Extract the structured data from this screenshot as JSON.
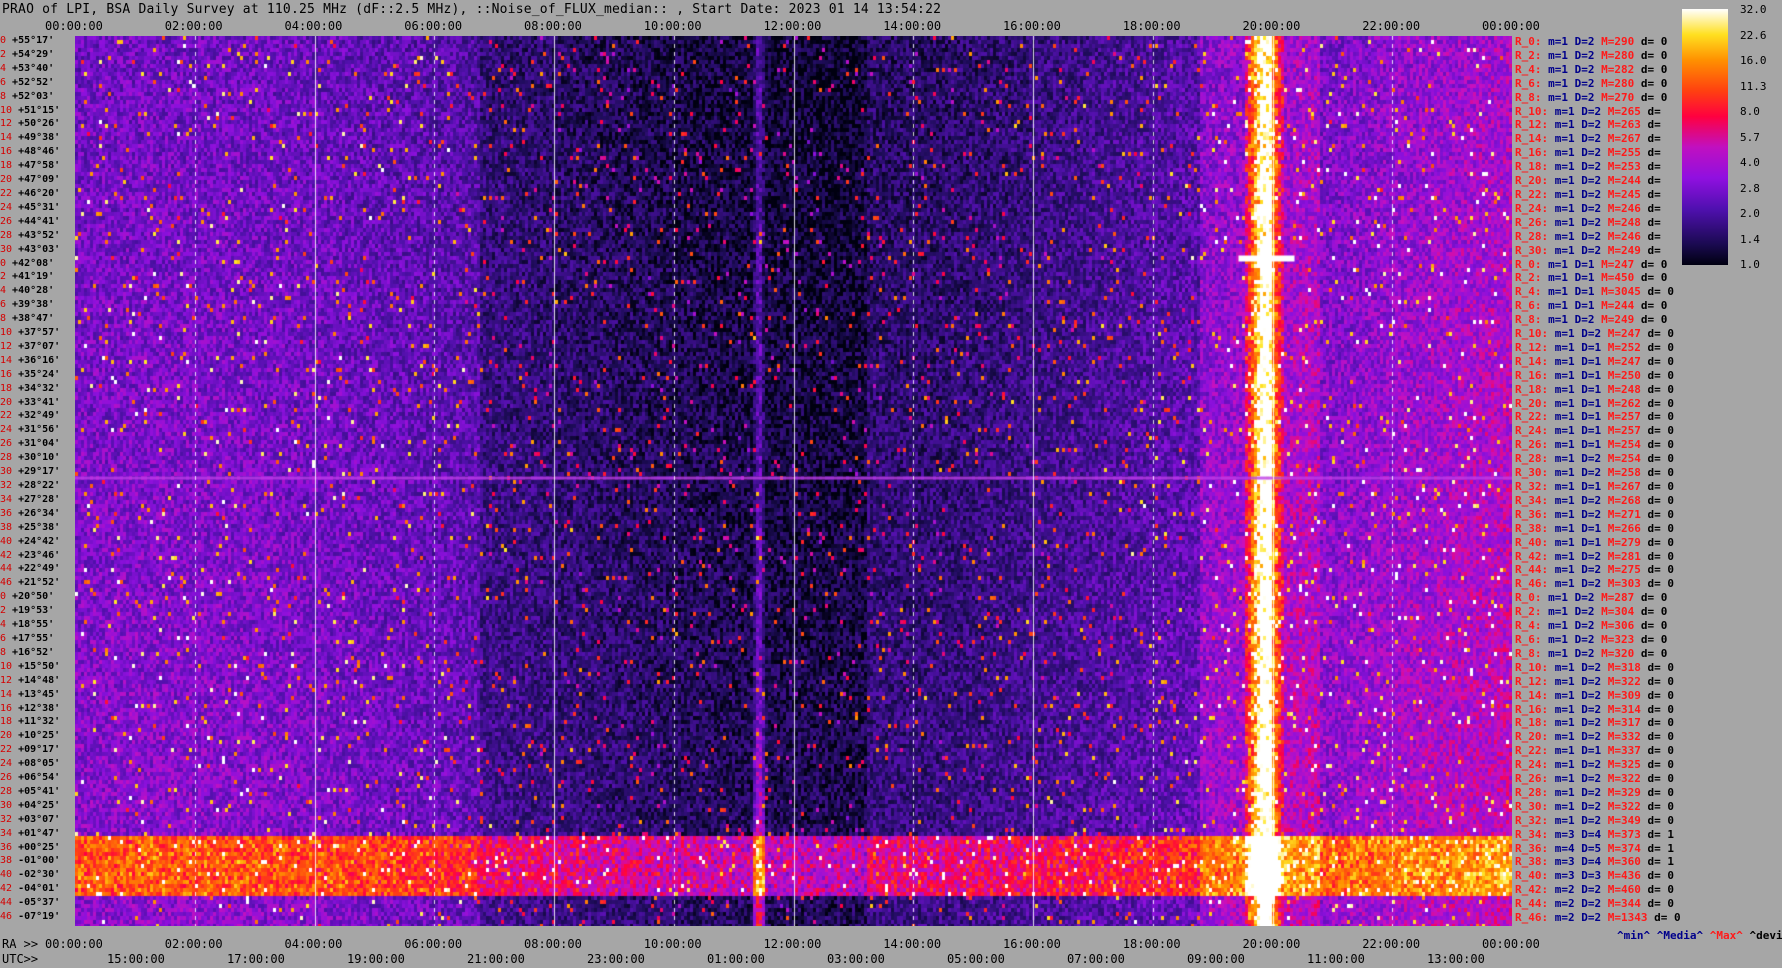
{
  "title": "PRAO of LPI, BSA Daily Survey at 110.25 MHz (dF::2.5 MHz), ::Noise_of_FLUX_median:: , Start Date: 2023 01 14 13:54:22",
  "chart_data": {
    "type": "heatmap",
    "title": "PRAO of LPI, BSA Daily Survey at 110.25 MHz (dF::2.5 MHz), ::Noise_of_FLUX_median:: , Start Date: 2023 01 14 13:54:22",
    "top_axis_ticks": [
      "00:00:00",
      "02:00:00",
      "04:00:00",
      "06:00:00",
      "08:00:00",
      "10:00:00",
      "12:00:00",
      "14:00:00",
      "16:00:00",
      "18:00:00",
      "20:00:00",
      "22:00:00",
      "00:00:00"
    ],
    "ra_prefix": "RA >>",
    "ra_ticks": [
      "00:00:00",
      "02:00:00",
      "04:00:00",
      "06:00:00",
      "08:00:00",
      "10:00:00",
      "12:00:00",
      "14:00:00",
      "16:00:00",
      "18:00:00",
      "20:00:00",
      "22:00:00",
      "00:00:00"
    ],
    "utc_prefix": "UTC>>",
    "utc_ticks": [
      "15:00:00",
      "17:00:00",
      "19:00:00",
      "21:00:00",
      "23:00:00",
      "01:00:00",
      "03:00:00",
      "05:00:00",
      "07:00:00",
      "09:00:00",
      "11:00:00",
      "13:00:00"
    ],
    "dec_labels": [
      {
        "i": "0",
        "d": "+55°17'"
      },
      {
        "i": "2",
        "d": "+54°29'"
      },
      {
        "i": "4",
        "d": "+53°40'"
      },
      {
        "i": "6",
        "d": "+52°52'"
      },
      {
        "i": "8",
        "d": "+52°03'"
      },
      {
        "i": "10",
        "d": "+51°15'"
      },
      {
        "i": "12",
        "d": "+50°26'"
      },
      {
        "i": "14",
        "d": "+49°38'"
      },
      {
        "i": "16",
        "d": "+48°46'"
      },
      {
        "i": "18",
        "d": "+47°58'"
      },
      {
        "i": "20",
        "d": "+47°09'"
      },
      {
        "i": "22",
        "d": "+46°20'"
      },
      {
        "i": "24",
        "d": "+45°31'"
      },
      {
        "i": "26",
        "d": "+44°41'"
      },
      {
        "i": "28",
        "d": "+43°52'"
      },
      {
        "i": "30",
        "d": "+43°03'"
      },
      {
        "i": "0",
        "d": "+42°08'"
      },
      {
        "i": "2",
        "d": "+41°19'"
      },
      {
        "i": "4",
        "d": "+40°28'"
      },
      {
        "i": "6",
        "d": "+39°38'"
      },
      {
        "i": "8",
        "d": "+38°47'"
      },
      {
        "i": "10",
        "d": "+37°57'"
      },
      {
        "i": "12",
        "d": "+37°07'"
      },
      {
        "i": "14",
        "d": "+36°16'"
      },
      {
        "i": "16",
        "d": "+35°24'"
      },
      {
        "i": "18",
        "d": "+34°32'"
      },
      {
        "i": "20",
        "d": "+33°41'"
      },
      {
        "i": "22",
        "d": "+32°49'"
      },
      {
        "i": "24",
        "d": "+31°56'"
      },
      {
        "i": "26",
        "d": "+31°04'"
      },
      {
        "i": "28",
        "d": "+30°10'"
      },
      {
        "i": "30",
        "d": "+29°17'"
      },
      {
        "i": "32",
        "d": "+28°22'"
      },
      {
        "i": "34",
        "d": "+27°28'"
      },
      {
        "i": "36",
        "d": "+26°34'"
      },
      {
        "i": "38",
        "d": "+25°38'"
      },
      {
        "i": "40",
        "d": "+24°42'"
      },
      {
        "i": "42",
        "d": "+23°46'"
      },
      {
        "i": "44",
        "d": "+22°49'"
      },
      {
        "i": "46",
        "d": "+21°52'"
      },
      {
        "i": "0",
        "d": "+20°50'"
      },
      {
        "i": "2",
        "d": "+19°53'"
      },
      {
        "i": "4",
        "d": "+18°55'"
      },
      {
        "i": "6",
        "d": "+17°55'"
      },
      {
        "i": "8",
        "d": "+16°52'"
      },
      {
        "i": "10",
        "d": "+15°50'"
      },
      {
        "i": "12",
        "d": "+14°48'"
      },
      {
        "i": "14",
        "d": "+13°45'"
      },
      {
        "i": "16",
        "d": "+12°38'"
      },
      {
        "i": "18",
        "d": "+11°32'"
      },
      {
        "i": "20",
        "d": "+10°25'"
      },
      {
        "i": "22",
        "d": "+09°17'"
      },
      {
        "i": "24",
        "d": "+08°05'"
      },
      {
        "i": "26",
        "d": "+06°54'"
      },
      {
        "i": "28",
        "d": "+05°41'"
      },
      {
        "i": "30",
        "d": "+04°25'"
      },
      {
        "i": "32",
        "d": "+03°07'"
      },
      {
        "i": "34",
        "d": "+01°47'"
      },
      {
        "i": "36",
        "d": "+00°25'"
      },
      {
        "i": "38",
        "d": "-01°00'"
      },
      {
        "i": "40",
        "d": "-02°30'"
      },
      {
        "i": "42",
        "d": "-04°01'"
      },
      {
        "i": "44",
        "d": "-05°37'"
      },
      {
        "i": "46",
        "d": "-07°19'"
      }
    ],
    "right_labels": [
      [
        "R_0:",
        "m=1",
        "D=2",
        "M=290",
        "d= 0"
      ],
      [
        "R_2:",
        "m=1",
        "D=2",
        "M=280",
        "d= 0"
      ],
      [
        "R_4:",
        "m=1",
        "D=2",
        "M=282",
        "d= 0"
      ],
      [
        "R_6:",
        "m=1",
        "D=2",
        "M=280",
        "d= 0"
      ],
      [
        "R_8:",
        "m=1",
        "D=2",
        "M=270",
        "d= 0"
      ],
      [
        "R_10:",
        "m=1",
        "D=2",
        "M=265",
        "d="
      ],
      [
        "R_12:",
        "m=1",
        "D=2",
        "M=263",
        "d="
      ],
      [
        "R_14:",
        "m=1",
        "D=2",
        "M=267",
        "d="
      ],
      [
        "R_16:",
        "m=1",
        "D=2",
        "M=255",
        "d="
      ],
      [
        "R_18:",
        "m=1",
        "D=2",
        "M=253",
        "d="
      ],
      [
        "R_20:",
        "m=1",
        "D=2",
        "M=244",
        "d="
      ],
      [
        "R_22:",
        "m=1",
        "D=2",
        "M=245",
        "d="
      ],
      [
        "R_24:",
        "m=1",
        "D=2",
        "M=246",
        "d="
      ],
      [
        "R_26:",
        "m=1",
        "D=2",
        "M=248",
        "d="
      ],
      [
        "R_28:",
        "m=1",
        "D=2",
        "M=246",
        "d="
      ],
      [
        "R_30:",
        "m=1",
        "D=2",
        "M=249",
        "d="
      ],
      [
        "R_0:",
        "m=1",
        "D=1",
        "M=247",
        "d= 0"
      ],
      [
        "R_2:",
        "m=1",
        "D=1",
        "M=450",
        "d= 0"
      ],
      [
        "R_4:",
        "m=1",
        "D=1",
        "M=3045",
        "d= 0"
      ],
      [
        "R_6:",
        "m=1",
        "D=1",
        "M=244",
        "d= 0"
      ],
      [
        "R_8:",
        "m=1",
        "D=2",
        "M=249",
        "d= 0"
      ],
      [
        "R_10:",
        "m=1",
        "D=2",
        "M=247",
        "d= 0"
      ],
      [
        "R_12:",
        "m=1",
        "D=1",
        "M=252",
        "d= 0"
      ],
      [
        "R_14:",
        "m=1",
        "D=1",
        "M=247",
        "d= 0"
      ],
      [
        "R_16:",
        "m=1",
        "D=1",
        "M=250",
        "d= 0"
      ],
      [
        "R_18:",
        "m=1",
        "D=1",
        "M=248",
        "d= 0"
      ],
      [
        "R_20:",
        "m=1",
        "D=1",
        "M=262",
        "d= 0"
      ],
      [
        "R_22:",
        "m=1",
        "D=1",
        "M=257",
        "d= 0"
      ],
      [
        "R_24:",
        "m=1",
        "D=1",
        "M=257",
        "d= 0"
      ],
      [
        "R_26:",
        "m=1",
        "D=1",
        "M=254",
        "d= 0"
      ],
      [
        "R_28:",
        "m=1",
        "D=2",
        "M=254",
        "d= 0"
      ],
      [
        "R_30:",
        "m=1",
        "D=2",
        "M=258",
        "d= 0"
      ],
      [
        "R_32:",
        "m=1",
        "D=1",
        "M=267",
        "d= 0"
      ],
      [
        "R_34:",
        "m=1",
        "D=2",
        "M=268",
        "d= 0"
      ],
      [
        "R_36:",
        "m=1",
        "D=2",
        "M=271",
        "d= 0"
      ],
      [
        "R_38:",
        "m=1",
        "D=1",
        "M=266",
        "d= 0"
      ],
      [
        "R_40:",
        "m=1",
        "D=1",
        "M=279",
        "d= 0"
      ],
      [
        "R_42:",
        "m=1",
        "D=2",
        "M=281",
        "d= 0"
      ],
      [
        "R_44:",
        "m=1",
        "D=2",
        "M=275",
        "d= 0"
      ],
      [
        "R_46:",
        "m=1",
        "D=2",
        "M=303",
        "d= 0"
      ],
      [
        "R_0:",
        "m=1",
        "D=2",
        "M=287",
        "d= 0"
      ],
      [
        "R_2:",
        "m=1",
        "D=2",
        "M=304",
        "d= 0"
      ],
      [
        "R_4:",
        "m=1",
        "D=2",
        "M=306",
        "d= 0"
      ],
      [
        "R_6:",
        "m=1",
        "D=2",
        "M=323",
        "d= 0"
      ],
      [
        "R_8:",
        "m=1",
        "D=2",
        "M=320",
        "d= 0"
      ],
      [
        "R_10:",
        "m=1",
        "D=2",
        "M=318",
        "d= 0"
      ],
      [
        "R_12:",
        "m=1",
        "D=2",
        "M=322",
        "d= 0"
      ],
      [
        "R_14:",
        "m=1",
        "D=2",
        "M=309",
        "d= 0"
      ],
      [
        "R_16:",
        "m=1",
        "D=2",
        "M=314",
        "d= 0"
      ],
      [
        "R_18:",
        "m=1",
        "D=2",
        "M=317",
        "d= 0"
      ],
      [
        "R_20:",
        "m=1",
        "D=2",
        "M=332",
        "d= 0"
      ],
      [
        "R_22:",
        "m=1",
        "D=1",
        "M=337",
        "d= 0"
      ],
      [
        "R_24:",
        "m=1",
        "D=2",
        "M=325",
        "d= 0"
      ],
      [
        "R_26:",
        "m=1",
        "D=2",
        "M=322",
        "d= 0"
      ],
      [
        "R_28:",
        "m=1",
        "D=2",
        "M=329",
        "d= 0"
      ],
      [
        "R_30:",
        "m=1",
        "D=2",
        "M=322",
        "d= 0"
      ],
      [
        "R_32:",
        "m=1",
        "D=2",
        "M=349",
        "d= 0"
      ],
      [
        "R_34:",
        "m=3",
        "D=4",
        "M=373",
        "d= 1"
      ],
      [
        "R_36:",
        "m=4",
        "D=5",
        "M=374",
        "d= 1"
      ],
      [
        "R_38:",
        "m=3",
        "D=4",
        "M=360",
        "d= 1"
      ],
      [
        "R_40:",
        "m=3",
        "D=3",
        "M=436",
        "d= 0"
      ],
      [
        "R_42:",
        "m=2",
        "D=2",
        "M=460",
        "d= 0"
      ],
      [
        "R_44:",
        "m=2",
        "D=2",
        "M=344",
        "d= 0"
      ],
      [
        "R_46:",
        "m=2",
        "D=2",
        "M=1343",
        "d= 0"
      ]
    ],
    "colorbar": {
      "ticks": [
        "32.0",
        "22.6",
        "16.0",
        "11.3",
        "8.0",
        "5.7",
        "4.0",
        "2.8",
        "2.0",
        "1.4",
        "1.0"
      ],
      "scale": "log",
      "range": [
        1.0,
        32.0
      ]
    },
    "legend": {
      "min": "^min^",
      "median": "^Media^",
      "max": "^Max^",
      "devia": "^devia^"
    },
    "features": [
      {
        "kind": "bright-column",
        "ra_hours": 19.75,
        "intensity": 30
      },
      {
        "kind": "bright-column",
        "ra_hours": 19.95,
        "intensity": 26
      },
      {
        "kind": "hot-spot",
        "ra_hours": 19.9,
        "dec": "+40°28'",
        "intensity": 32
      },
      {
        "kind": "equatorial-band",
        "dec_from": "+01°47'",
        "dec_to": "-02°30'",
        "intensity": 10
      },
      {
        "kind": "spike-column",
        "ra_hours": 11.4,
        "intensity": 22
      }
    ]
  },
  "colors": {
    "background": "#a6a6a6",
    "label_red": "#ff1a1a",
    "label_blue": "#00008b"
  }
}
